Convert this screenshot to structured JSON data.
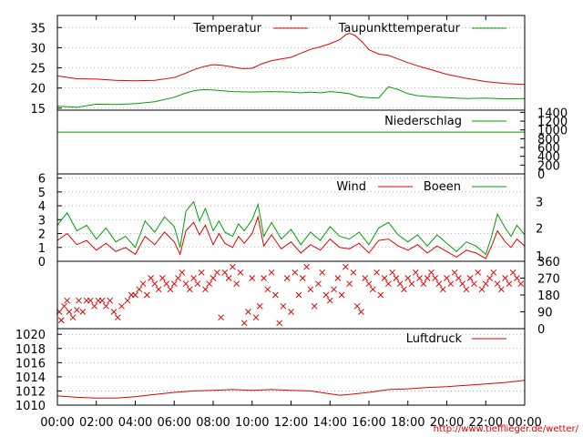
{
  "source_url": "http://www.tiefflieger.de/wetter/",
  "colors": {
    "red": "#e00000",
    "green": "#00a000",
    "grid": "#a0a0a0"
  },
  "chart_data": [
    {
      "id": "temperature",
      "type": "line",
      "x_tick_labels": [
        "00:00",
        "02:00",
        "04:00",
        "06:00",
        "08:00",
        "10:00",
        "12:00",
        "14:00",
        "16:00",
        "18:00",
        "20:00",
        "22:00",
        "00:00"
      ],
      "xlim": [
        0,
        24
      ],
      "ylim": [
        14.5,
        38
      ],
      "y_ticks": [
        15,
        20,
        25,
        30,
        35
      ],
      "grid": true,
      "legend_position": "top",
      "series": [
        {
          "name": "Temperatur",
          "color": "#e00000",
          "x": [
            0,
            1,
            2,
            3,
            4,
            5,
            6,
            6.5,
            7,
            7.5,
            8,
            8.5,
            9,
            9.5,
            10,
            10.5,
            11,
            11.5,
            12,
            12.5,
            13,
            13.5,
            14,
            14.5,
            14.8,
            15,
            15.3,
            15.7,
            16,
            16.5,
            17,
            17.5,
            18,
            18.5,
            19,
            19.5,
            20,
            21,
            22,
            23,
            24
          ],
          "values": [
            23,
            22.3,
            22.2,
            21.9,
            21.8,
            21.9,
            22.6,
            23.5,
            24.5,
            25.3,
            25.8,
            25.6,
            25.2,
            24.8,
            24.9,
            26,
            26.8,
            27.2,
            27.6,
            28.6,
            29.6,
            30.2,
            31,
            32,
            33.2,
            33.6,
            33,
            31.2,
            29.5,
            28.4,
            28.1,
            27.2,
            26.3,
            25.5,
            24.8,
            24.1,
            23.4,
            22.4,
            21.6,
            21.1,
            20.9
          ]
        },
        {
          "name": "Taupunkttemperatur",
          "color": "#00a000",
          "x": [
            0,
            1,
            2,
            3,
            4,
            5,
            6,
            6.5,
            7,
            7.5,
            8,
            8.5,
            9,
            10,
            11,
            12,
            12.5,
            13,
            13.5,
            14,
            14.5,
            15,
            15.5,
            16,
            16.5,
            17,
            17.5,
            18,
            18.5,
            19,
            20,
            21,
            22,
            23,
            24
          ],
          "values": [
            15.5,
            15.2,
            16,
            15.9,
            16.1,
            16.6,
            17.7,
            18.6,
            19.3,
            19.6,
            19.5,
            19.3,
            19.1,
            19,
            19.1,
            19,
            18.8,
            19,
            18.8,
            19.1,
            18.9,
            18.6,
            17.8,
            17.6,
            17.5,
            20.3,
            19.6,
            18.6,
            18.1,
            17.9,
            17.6,
            17.4,
            17.5,
            17.3,
            17.4
          ]
        }
      ]
    },
    {
      "id": "precipitation",
      "type": "line",
      "xlim": [
        0,
        24
      ],
      "ylim": [
        0,
        1450
      ],
      "y_ticks_right": [
        0,
        200,
        400,
        600,
        800,
        1000,
        1200,
        1400
      ],
      "y_tick_labels_right": [
        "0",
        "200",
        "400",
        "600",
        "800",
        "1000",
        "1200",
        "1400"
      ],
      "grid": true,
      "series": [
        {
          "name": "Niederschlag",
          "color": "#00a000",
          "x": [
            0,
            24
          ],
          "values": [
            950,
            950
          ]
        }
      ]
    },
    {
      "id": "wind",
      "type": "line",
      "xlim": [
        0,
        24
      ],
      "ylim": [
        0,
        6.3
      ],
      "y_ticks": [
        0,
        1,
        2,
        3,
        4,
        5,
        6
      ],
      "right_labels": [
        {
          "label": "3",
          "value": 4.3
        },
        {
          "label": "2",
          "value": 2.4
        },
        {
          "label": "1",
          "value": 0.4
        }
      ],
      "grid": true,
      "series": [
        {
          "name": "Wind",
          "color": "#e00000",
          "x": [
            0,
            0.5,
            1,
            1.5,
            2,
            2.5,
            3,
            3.5,
            4,
            4.5,
            5,
            5.5,
            6,
            6.3,
            6.6,
            7,
            7.3,
            7.6,
            8,
            8.3,
            8.6,
            9,
            9.3,
            9.6,
            10,
            10.3,
            10.6,
            11,
            11.5,
            12,
            12.5,
            13,
            13.5,
            14,
            14.5,
            15,
            15.5,
            16,
            16.5,
            17,
            17.5,
            18,
            18.5,
            19,
            19.5,
            20,
            20.5,
            21,
            21.5,
            22,
            22.3,
            22.6,
            23,
            23.3,
            23.6,
            24
          ],
          "values": [
            1.5,
            2,
            1.2,
            1.5,
            0.8,
            1.3,
            0.7,
            1,
            0.5,
            1.8,
            1.2,
            2.1,
            1.4,
            0.5,
            2.2,
            2.8,
            1.9,
            2.6,
            1.2,
            2,
            1.3,
            1,
            1.8,
            1.3,
            2,
            3.2,
            1.1,
            1.9,
            0.9,
            1.4,
            0.6,
            1.2,
            0.8,
            1.6,
            1,
            0.9,
            1.3,
            0.6,
            1.5,
            1.6,
            1.1,
            0.8,
            1.2,
            0.6,
            1.1,
            0.7,
            0.3,
            0.8,
            0.6,
            0.2,
            1.1,
            2.2,
            1.4,
            1,
            1.6,
            1.1
          ]
        },
        {
          "name": "Boeen",
          "color": "#00a000",
          "x": [
            0,
            0.5,
            1,
            1.5,
            2,
            2.5,
            3,
            3.5,
            4,
            4.5,
            5,
            5.5,
            6,
            6.3,
            6.6,
            7,
            7.3,
            7.6,
            8,
            8.3,
            8.6,
            9,
            9.3,
            9.6,
            10,
            10.3,
            10.6,
            11,
            11.5,
            12,
            12.5,
            13,
            13.5,
            14,
            14.5,
            15,
            15.5,
            16,
            16.5,
            17,
            17.5,
            18,
            18.5,
            19,
            19.5,
            20,
            20.5,
            21,
            21.5,
            22,
            22.3,
            22.6,
            23,
            23.3,
            23.6,
            24
          ],
          "values": [
            2.6,
            3.5,
            2.2,
            2.6,
            1.6,
            2.4,
            1.4,
            1.8,
            1,
            2.9,
            2.1,
            3.2,
            2.5,
            1,
            3.6,
            4.3,
            2.9,
            3.8,
            2.2,
            2.9,
            2.1,
            1.8,
            2.7,
            2.2,
            3,
            4.1,
            1.8,
            2.8,
            1.6,
            2.3,
            1.2,
            2.1,
            1.5,
            2.5,
            1.8,
            1.6,
            2.1,
            1.2,
            2.4,
            2.8,
            1.9,
            1.4,
            1.9,
            1.1,
            1.9,
            1.3,
            0.7,
            1.4,
            1.1,
            0.5,
            1.8,
            3.4,
            2.4,
            1.8,
            2.6,
            1.9
          ]
        }
      ]
    },
    {
      "id": "wind_direction",
      "type": "scatter",
      "xlim": [
        0,
        24
      ],
      "ylim": [
        0,
        360
      ],
      "y_ticks_right": [
        0,
        90,
        180,
        270,
        360
      ],
      "y_tick_labels_right": [
        "0",
        "90",
        "180",
        "270",
        "360"
      ],
      "marker": "x",
      "color": "#e00000",
      "x": [
        0.1,
        0.2,
        0.35,
        0.5,
        0.6,
        0.8,
        1,
        1.1,
        1.3,
        1.5,
        1.7,
        1.9,
        2.1,
        2.3,
        2.5,
        2.7,
        2.9,
        3.1,
        3.3,
        3.6,
        3.8,
        4,
        4.2,
        4.4,
        4.6,
        4.8,
        5,
        5.2,
        5.4,
        5.6,
        5.8,
        6,
        6.2,
        6.4,
        6.6,
        6.8,
        7,
        7.2,
        7.4,
        7.6,
        7.8,
        8,
        8.2,
        8.4,
        8.6,
        8.8,
        9,
        9.2,
        9.4,
        9.6,
        9.8,
        10,
        10.2,
        10.4,
        10.6,
        10.8,
        11,
        11.2,
        11.4,
        11.6,
        11.8,
        12,
        12.2,
        12.4,
        12.6,
        12.8,
        13,
        13.2,
        13.4,
        13.6,
        13.8,
        14,
        14.2,
        14.4,
        14.6,
        14.8,
        15,
        15.2,
        15.4,
        15.6,
        15.8,
        16,
        16.2,
        16.4,
        16.6,
        16.8,
        17,
        17.2,
        17.4,
        17.6,
        17.8,
        18,
        18.2,
        18.4,
        18.6,
        18.8,
        19,
        19.2,
        19.4,
        19.6,
        19.8,
        20,
        20.2,
        20.4,
        20.6,
        20.8,
        21,
        21.2,
        21.4,
        21.6,
        21.8,
        22,
        22.2,
        22.4,
        22.6,
        22.8,
        23,
        23.2,
        23.4,
        23.6,
        23.8
      ],
      "values": [
        90,
        45,
        120,
        150,
        90,
        60,
        100,
        150,
        90,
        150,
        150,
        120,
        150,
        150,
        120,
        150,
        90,
        60,
        120,
        150,
        180,
        180,
        210,
        240,
        180,
        270,
        240,
        210,
        270,
        240,
        210,
        240,
        270,
        300,
        240,
        210,
        270,
        240,
        300,
        210,
        240,
        270,
        300,
        60,
        300,
        270,
        330,
        240,
        300,
        30,
        90,
        270,
        60,
        120,
        270,
        210,
        300,
        180,
        30,
        120,
        270,
        90,
        300,
        180,
        270,
        330,
        210,
        120,
        240,
        300,
        180,
        150,
        210,
        270,
        180,
        330,
        240,
        300,
        120,
        90,
        270,
        240,
        210,
        300,
        180,
        270,
        240,
        300,
        270,
        240,
        210,
        270,
        240,
        300,
        270,
        240,
        270,
        300,
        270,
        240,
        210,
        270,
        240,
        300,
        270,
        240,
        210,
        270,
        240,
        300,
        210,
        240,
        270,
        300,
        240,
        210,
        270,
        240,
        300,
        270,
        240
      ]
    },
    {
      "id": "pressure",
      "type": "line",
      "xlim": [
        0,
        24
      ],
      "ylim": [
        1010,
        1020.8
      ],
      "y_ticks": [
        1010,
        1012,
        1014,
        1016,
        1018,
        1020
      ],
      "grid": true,
      "series": [
        {
          "name": "Luftdruck",
          "color": "#e00000",
          "x": [
            0,
            1,
            2,
            3,
            4,
            5,
            6,
            7,
            8,
            9,
            10,
            11,
            12,
            13,
            14,
            14.5,
            15,
            16,
            17,
            18,
            19,
            20,
            21,
            22,
            23,
            24
          ],
          "values": [
            1011.3,
            1011.1,
            1011,
            1011,
            1011.2,
            1011.5,
            1011.8,
            1012,
            1012.1,
            1012.2,
            1012.1,
            1012.2,
            1012.1,
            1012,
            1011.6,
            1011.4,
            1011.5,
            1011.8,
            1012.2,
            1012.3,
            1012.5,
            1012.6,
            1012.8,
            1013,
            1013.2,
            1013.5
          ]
        }
      ]
    }
  ]
}
